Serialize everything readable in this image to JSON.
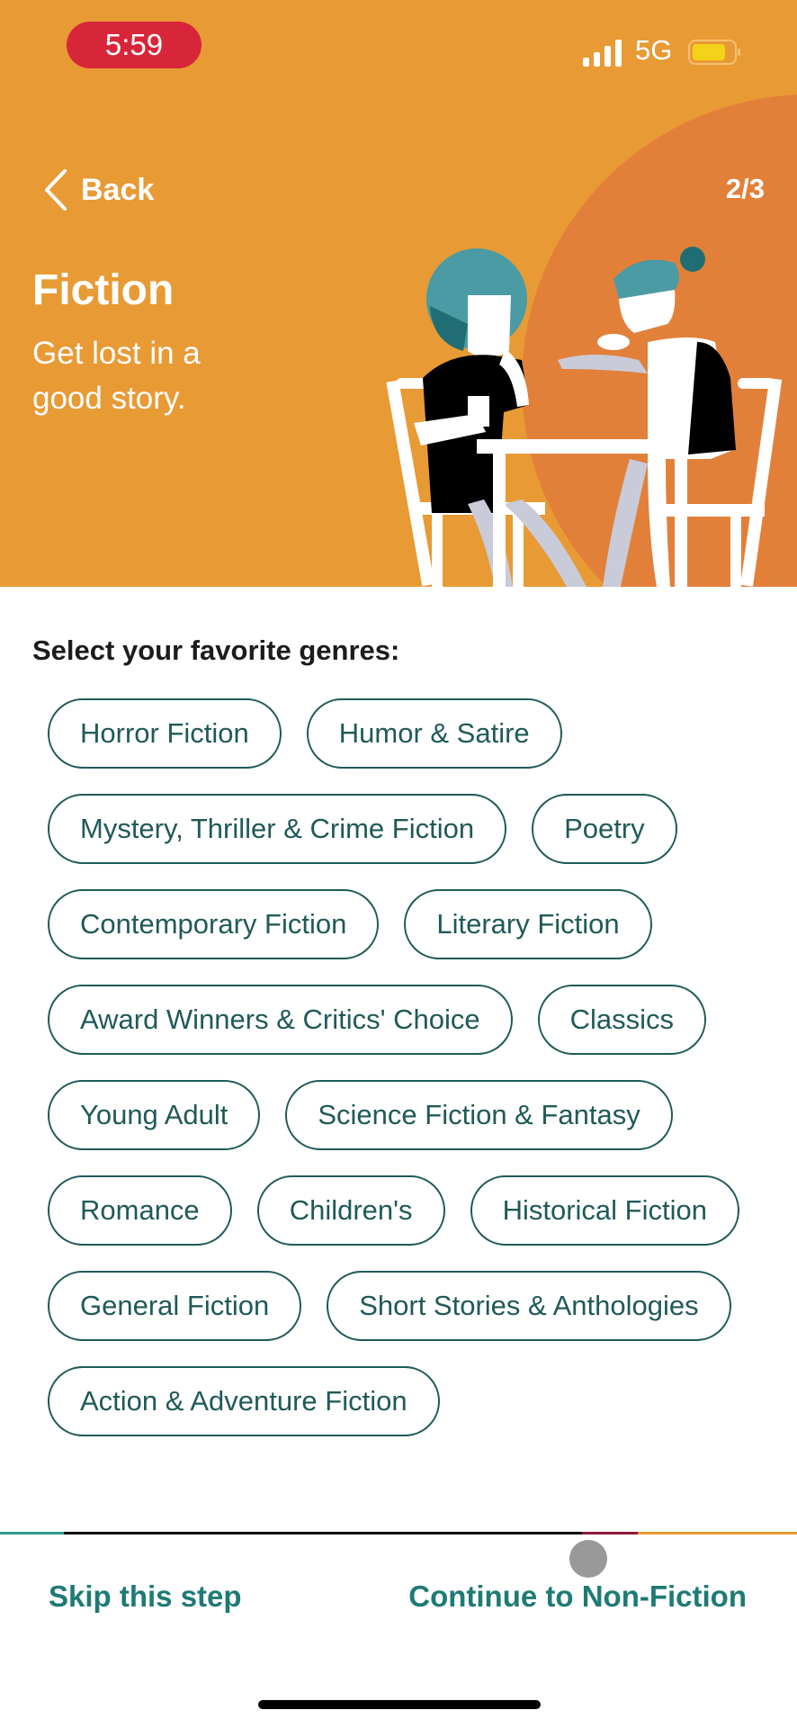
{
  "status_bar": {
    "time": "5:59",
    "network": "5G",
    "signal_icon": "cellular-signal-icon",
    "battery_icon": "battery-icon",
    "battery_color": "#F5D21A"
  },
  "header": {
    "back_label": "Back",
    "step": "2/3",
    "title": "Fiction",
    "subtitle": "Get lost in a good story.",
    "illustration": "two-people-at-cafe-table-illustration",
    "background_color": "#E89A35",
    "accent_circle_color": "#E2803A"
  },
  "genres": {
    "prompt": "Select your favorite genres:",
    "items": [
      {
        "label": "Horror Fiction"
      },
      {
        "label": "Humor & Satire"
      },
      {
        "label": "Mystery, Thriller & Crime Fiction"
      },
      {
        "label": "Poetry"
      },
      {
        "label": "Contemporary Fiction"
      },
      {
        "label": "Literary Fiction"
      },
      {
        "label": "Award Winners & Critics' Choice"
      },
      {
        "label": "Classics"
      },
      {
        "label": "Young Adult"
      },
      {
        "label": "Science Fiction & Fantasy"
      },
      {
        "label": "Romance"
      },
      {
        "label": "Children's"
      },
      {
        "label": "Historical Fiction"
      },
      {
        "label": "General Fiction"
      },
      {
        "label": "Short Stories & Anthologies"
      },
      {
        "label": "Action & Adventure Fiction"
      }
    ],
    "chip_color": "#1F5A58"
  },
  "footer": {
    "skip_label": "Skip this step",
    "continue_label": "Continue to Non-Fiction",
    "link_color": "#1E7A74"
  }
}
